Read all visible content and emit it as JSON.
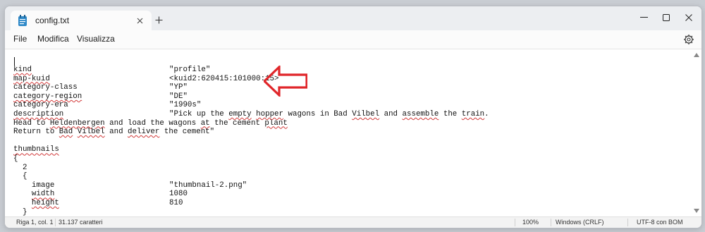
{
  "tab": {
    "title": "config.txt"
  },
  "menu": [
    "File",
    "Modifica",
    "Visualizza"
  ],
  "lines": [
    {
      "key": "kind",
      "val": "\"profile\""
    },
    {
      "key": "map-kuid",
      "val": "<kuid2:620415:101000:15>"
    },
    {
      "key": "category-class",
      "val": "\"YP\""
    },
    {
      "key": "category-region",
      "val": "\"DE\""
    },
    {
      "key": "category-era",
      "val": "\"1990s\""
    },
    {
      "key": "description",
      "val": "\"Pick up the empty hopper wagons in Bad Vilbel and assemble the train."
    },
    {
      "key": "Head to Heldenbergen and load the wagons at the cement plant",
      "val": ""
    },
    {
      "key": "Return to Bad Vilbel and deliver the cement\"",
      "val": ""
    },
    {
      "key": "",
      "val": ""
    },
    {
      "key": "thumbnails",
      "val": ""
    },
    {
      "key": "{",
      "val": ""
    },
    {
      "key": "  2",
      "val": ""
    },
    {
      "key": "  {",
      "val": ""
    },
    {
      "key": "    image",
      "val": "\"thumbnail-2.png\""
    },
    {
      "key": "    width",
      "val": "1080"
    },
    {
      "key": "    height",
      "val": "810"
    },
    {
      "key": "  }",
      "val": ""
    }
  ],
  "status": {
    "position": "Riga 1, col. 1",
    "chars": "31.137 caratteri",
    "zoom": "100%",
    "eol": "Windows (CRLF)",
    "encoding": "UTF-8 con BOM"
  },
  "colors": {
    "annotation_arrow": "#e0262a",
    "spellcheck": "#d23a3a"
  }
}
